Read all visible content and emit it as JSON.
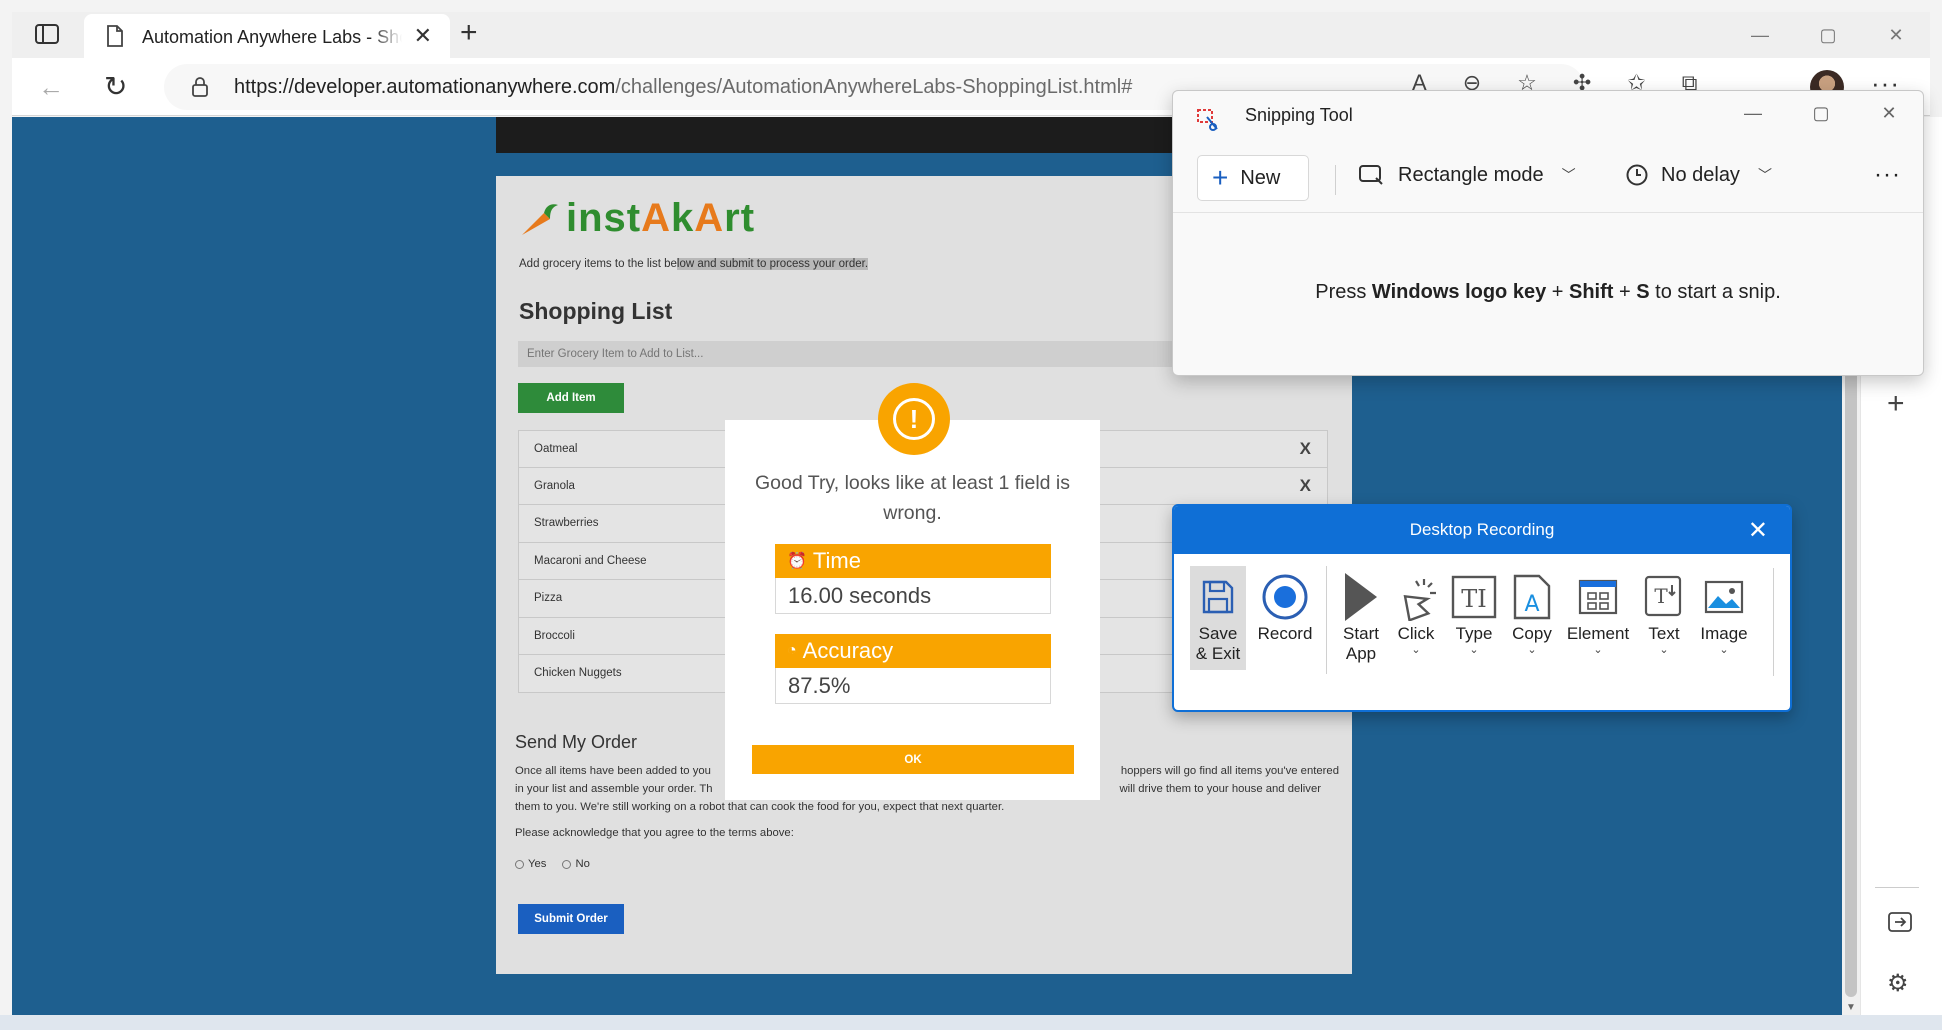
{
  "browser": {
    "tab_title": "Automation Anywhere Labs - Shopping List",
    "url_domain": "https://developer.automationanywhere.com",
    "url_path": "/challenges/AutomationAnywhereLabs-ShoppingList.html#"
  },
  "page": {
    "logo_text": "instAkArt",
    "subtitle_pre": "Add grocery items to the list be",
    "subtitle_hl": "low and submit to process your order.",
    "heading": "Shopping List",
    "input_placeholder": "Enter Grocery Item to Add to List...",
    "add_button": "Add Item",
    "items": [
      {
        "label": "Oatmeal",
        "remove": "X"
      },
      {
        "label": "Granola",
        "remove": "X"
      },
      {
        "label": "Strawberries",
        "remove": ""
      },
      {
        "label": "Macaroni and Cheese",
        "remove": ""
      },
      {
        "label": "Pizza",
        "remove": ""
      },
      {
        "label": "Broccoli",
        "remove": ""
      },
      {
        "label": "Chicken Nuggets",
        "remove": ""
      }
    ],
    "send_heading": "Send My Order",
    "para_left_1": "Once all items have been added to you",
    "para_right_1": "hoppers will go find all items you've entered",
    "para_left_2": "in your list and assemble your order. Th",
    "para_right_2": "will drive them to your house and deliver",
    "para_line_3": "them to you. We're still working on a robot that can cook the food for you, expect that next quarter.",
    "ack": "Please acknowledge that you agree to the terms above:",
    "radio_yes": "Yes",
    "radio_no": "No",
    "submit_button": "Submit Order"
  },
  "modal": {
    "message": "Good Try, looks like at least 1 field is wrong.",
    "time_label": "Time",
    "time_value": "16.00 seconds",
    "accuracy_label": "Accuracy",
    "accuracy_value": "87.5%",
    "ok_button": "OK"
  },
  "snipping_tool": {
    "title": "Snipping Tool",
    "new_button": "New",
    "mode": "Rectangle mode",
    "delay": "No delay",
    "hint_pre": "Press ",
    "hint_key1": "Windows logo key",
    "hint_plus1": " + ",
    "hint_key2": "Shift",
    "hint_plus2": " + ",
    "hint_key3": "S",
    "hint_post": " to start a snip."
  },
  "desktop_recording": {
    "title": "Desktop Recording",
    "save_line1": "Save",
    "save_line2": "& Exit",
    "record": "Record",
    "start_line1": "Start",
    "start_line2": "App",
    "click": "Click",
    "type": "Type",
    "copy": "Copy",
    "element": "Element",
    "text": "Text",
    "image": "Image"
  },
  "colors": {
    "page_bg": "#1e5f8f",
    "accent_orange": "#f9a400",
    "add_green": "#2e8b3a",
    "submit_blue": "#1a5fc0",
    "recording_blue": "#0f6fd6"
  }
}
